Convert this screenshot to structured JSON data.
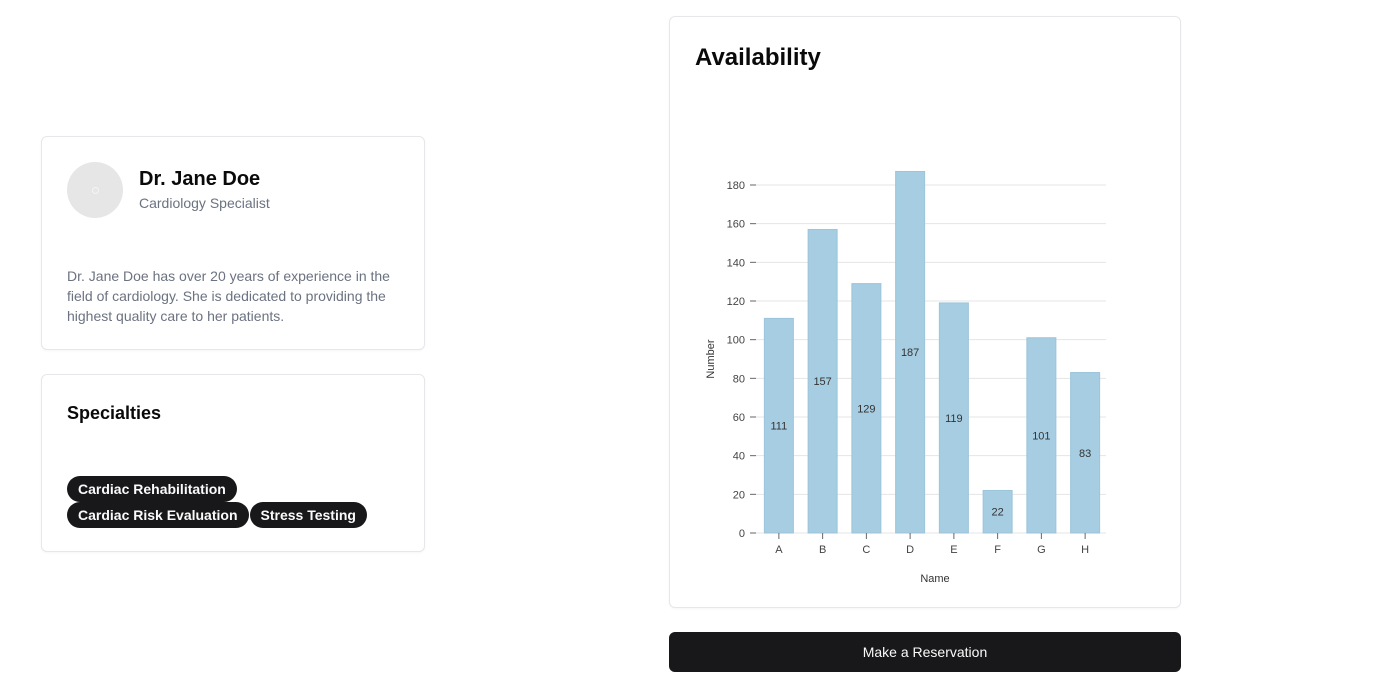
{
  "profile": {
    "name": "Dr. Jane Doe",
    "title": "Cardiology Specialist",
    "bio": "Dr. Jane Doe has over 20 years of experience in the field of cardiology. She is dedicated to providing the highest quality care to her patients."
  },
  "specialties": {
    "heading": "Specialties",
    "tags": [
      "Cardiac Rehabilitation",
      "Cardiac Risk Evaluation",
      "Stress Testing"
    ]
  },
  "availability": {
    "heading": "Availability"
  },
  "reserve_button": "Make a Reservation",
  "chart_data": {
    "type": "bar",
    "categories": [
      "A",
      "B",
      "C",
      "D",
      "E",
      "F",
      "G",
      "H"
    ],
    "values": [
      111,
      157,
      129,
      187,
      119,
      22,
      101,
      83
    ],
    "xlabel": "Name",
    "ylabel": "Number",
    "ylim": [
      0,
      180
    ],
    "yticks": [
      0,
      20,
      40,
      60,
      80,
      100,
      120,
      140,
      160,
      180
    ],
    "grid": true,
    "bar_color": "#a6cde1",
    "bar_stroke": "#9cc4da"
  }
}
